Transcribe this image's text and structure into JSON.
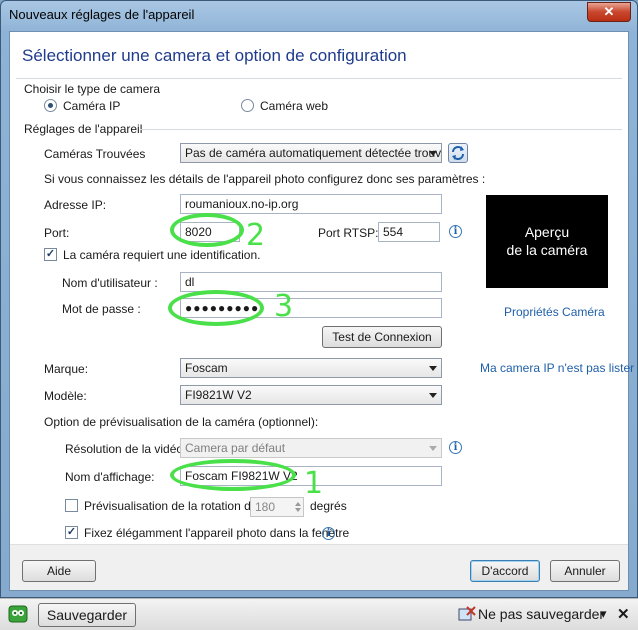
{
  "window": {
    "title": "Nouveaux réglages de l'appareil",
    "close_glyph": "✕"
  },
  "header": {
    "title": "Sélectionner une camera et option de configuration"
  },
  "camera_type": {
    "group_label": "Choisir le type de camera",
    "option_ip": "Caméra IP",
    "option_web": "Caméra web",
    "selected": "Caméra IP"
  },
  "device_settings": {
    "group_label": "Réglages de l'appareil",
    "cameras_found_label": "Caméras Trouvées",
    "cameras_found_value": "Pas de caméra automatiquement détectée trouvée",
    "hint": "Si vous connaissez les détails de l'appareil photo configurez donc ses paramètres :",
    "ip_label": "Adresse IP:",
    "ip_value": "roumanioux.no-ip.org",
    "port_label": "Port:",
    "port_value": "8020",
    "rtsp_label": "Port RTSP:",
    "rtsp_value": "554",
    "auth_label": "La caméra requiert une identification.",
    "auth_checked": true,
    "user_label": "Nom d'utilisateur :",
    "user_value": "dl",
    "password_label": "Mot de passe :",
    "password_value": "●●●●●●●●●",
    "test_button": "Test de Connexion",
    "brand_label": "Marque:",
    "brand_value": "Foscam",
    "model_label": "Modèle:",
    "model_value": "FI9821W V2"
  },
  "preview": {
    "line1": "Aperçu",
    "line2": "de la caméra",
    "properties_link": "Propriétés Caméra",
    "not_listed_link": "Ma camera IP n'est pas lister"
  },
  "preview_options": {
    "group_label": "Option de prévisualisation de la caméra (optionnel):",
    "resolution_label": "Résolution de la vidéo:",
    "resolution_value": "Camera par défaut",
    "display_name_label": "Nom d'affichage:",
    "display_name_value": "Foscam FI9821W V2",
    "rotation_label": "Prévisualisation de la rotation de:",
    "rotation_value": "180",
    "rotation_unit": "degrés",
    "rotation_checked": false,
    "fit_label": "Fixez élégamment l'appareil photo dans la fenêtre",
    "fit_checked": true
  },
  "annotations": {
    "n1": "1",
    "n2": "2",
    "n3": "3",
    "color": "#49e04a"
  },
  "footer": {
    "help": "Aide",
    "ok": "D'accord",
    "cancel": "Annuler"
  },
  "notification_bar": {
    "save_button": "Sauvegarder",
    "dont_save": "Ne pas sauvegarder",
    "dropdown_glyph": "▾",
    "close_glyph": "✕"
  }
}
